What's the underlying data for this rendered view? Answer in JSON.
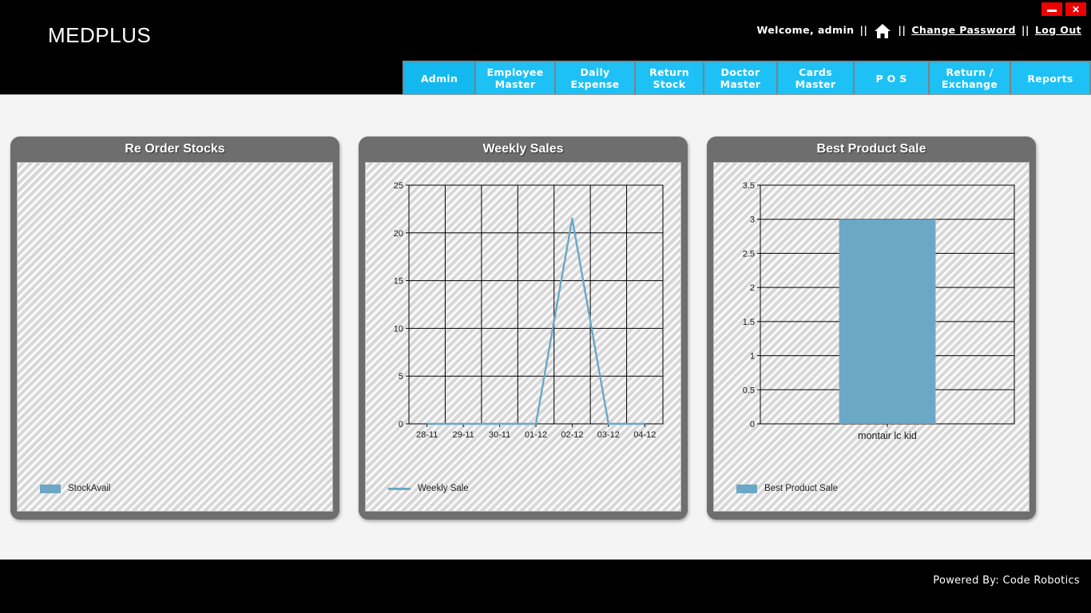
{
  "window": {
    "minimize_label": "–",
    "close_label": "✕"
  },
  "header": {
    "brand": "MEDPLUS",
    "welcome": "Welcome, admin",
    "separator": "||",
    "home_icon": "home-icon",
    "change_password": "Change Password",
    "log_out": "Log Out"
  },
  "nav": {
    "tabs": [
      {
        "label": "Admin",
        "selected": true
      },
      {
        "label": "Employee Master",
        "selected": false
      },
      {
        "label": "Daily Expense",
        "selected": false
      },
      {
        "label": "Return Stock",
        "selected": false
      },
      {
        "label": "Doctor Master",
        "selected": false
      },
      {
        "label": "Cards Master",
        "selected": false
      },
      {
        "label": "P O S",
        "selected": false
      },
      {
        "label": "Return / Exchange",
        "selected": false
      },
      {
        "label": "Reports",
        "selected": false
      }
    ]
  },
  "panels": {
    "reorder": {
      "title": "Re Order Stocks",
      "legend": "StockAvail"
    },
    "weekly": {
      "title": "Weekly Sales",
      "legend": "Weekly Sale"
    },
    "bestproduct": {
      "title": "Best Product Sale",
      "legend": "Best Product Sale"
    }
  },
  "footer": {
    "powered_by": "Powered By: Code Robotics"
  },
  "colors": {
    "accent": "#1dc1f5",
    "series": "#6ba8c6",
    "panel_frame": "#6e6e6e",
    "header_bg": "#000000",
    "close_btn": "#ee0000"
  },
  "chart_data": [
    {
      "type": "bar",
      "title": "Re Order Stocks",
      "categories": [],
      "values": [],
      "series": [
        {
          "name": "StockAvail",
          "values": []
        }
      ],
      "xlabel": "",
      "ylabel": "",
      "grid": false,
      "legend_position": "bottom-left",
      "note": "empty chart - no data plotted"
    },
    {
      "type": "line",
      "title": "Weekly Sales",
      "categories": [
        "28-11",
        "29-11",
        "30-11",
        "01-12",
        "02-12",
        "03-12",
        "04-12"
      ],
      "series": [
        {
          "name": "Weekly Sale",
          "values": [
            0,
            0,
            0,
            0,
            21.5,
            0,
            0
          ]
        }
      ],
      "xlabel": "",
      "ylabel": "",
      "ylim": [
        0,
        25
      ],
      "yticks": [
        0,
        5,
        10,
        15,
        20,
        25
      ],
      "grid": true,
      "legend_position": "bottom-left"
    },
    {
      "type": "bar",
      "title": "Best Product Sale",
      "categories": [
        "montair lc kid"
      ],
      "values": [
        3
      ],
      "series": [
        {
          "name": "Best Product Sale",
          "values": [
            3
          ]
        }
      ],
      "xlabel": "",
      "ylabel": "",
      "ylim": [
        0,
        3.5
      ],
      "yticks": [
        0,
        0.5,
        1,
        1.5,
        2,
        2.5,
        3,
        3.5
      ],
      "grid": true,
      "legend_position": "bottom-left"
    }
  ]
}
